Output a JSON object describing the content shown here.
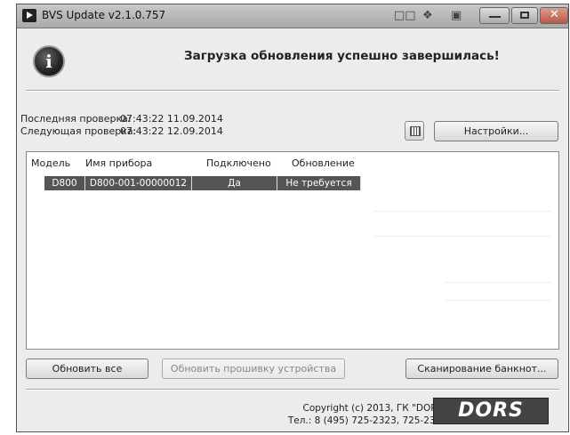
{
  "window": {
    "title": "BVS Update v2.1.0.757"
  },
  "headline": "Загрузка обновления успешно завершилась!",
  "checks": {
    "last_label": "Последняя проверка:",
    "last_value": "07:43:22 11.09.2014",
    "next_label": "Следующая проверка:",
    "next_value": "07:43:22 12.09.2014"
  },
  "settings_button": "Настройки...",
  "table": {
    "columns": [
      "Модель",
      "Имя прибора",
      "Подключено",
      "Обновление"
    ],
    "rows": [
      {
        "model": "D800",
        "name": "D800-001-00000012",
        "connected": "Да",
        "update": "Не требуется"
      }
    ]
  },
  "buttons": {
    "update_all": "Обновить все",
    "update_firmware": "Обновить прошивку устройства",
    "scan_banknotes": "Сканирование банкнот..."
  },
  "footer": {
    "copyright": "Copyright (c) 2013, ГК \"DORS\"",
    "phone": "Тел.: 8 (495) 725-2323, 725-2325",
    "logo_text": "DORS"
  }
}
